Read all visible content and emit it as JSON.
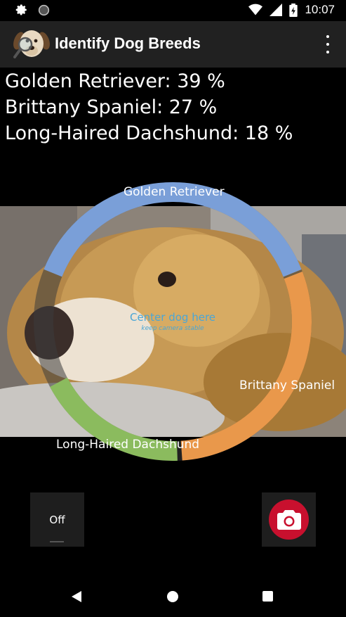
{
  "status_bar": {
    "time": "10:07",
    "icons": [
      "settings-icon",
      "circle-icon",
      "wifi-icon",
      "signal-icon",
      "battery-icon"
    ]
  },
  "app_bar": {
    "title": "Identify Dog Breeds",
    "logo": "dog-magnifier-logo",
    "menu_icon": "overflow-menu-icon"
  },
  "results": [
    {
      "text": "Golden Retriever: 39 %"
    },
    {
      "text": "Brittany Spaniel: 27 %"
    },
    {
      "text": "Long-Haired Dachshund: 18 %"
    }
  ],
  "ring": {
    "segments": [
      {
        "label": "Golden Retriever",
        "percent": 39,
        "color": "#7a9fd8"
      },
      {
        "label": "Brittany Spaniel",
        "percent": 27,
        "color": "#e9984b"
      },
      {
        "label": "Long-Haired Dachshund",
        "percent": 18,
        "color": "#8bbb5e"
      }
    ],
    "center_text": "Center dog here",
    "center_subtext": "keep camera stable"
  },
  "controls": {
    "flash_label": "Off",
    "capture_icon": "camera-icon",
    "capture_color": "#c8102e"
  },
  "nav_bar": {
    "icons": [
      "back-icon",
      "home-icon",
      "recents-icon"
    ]
  }
}
